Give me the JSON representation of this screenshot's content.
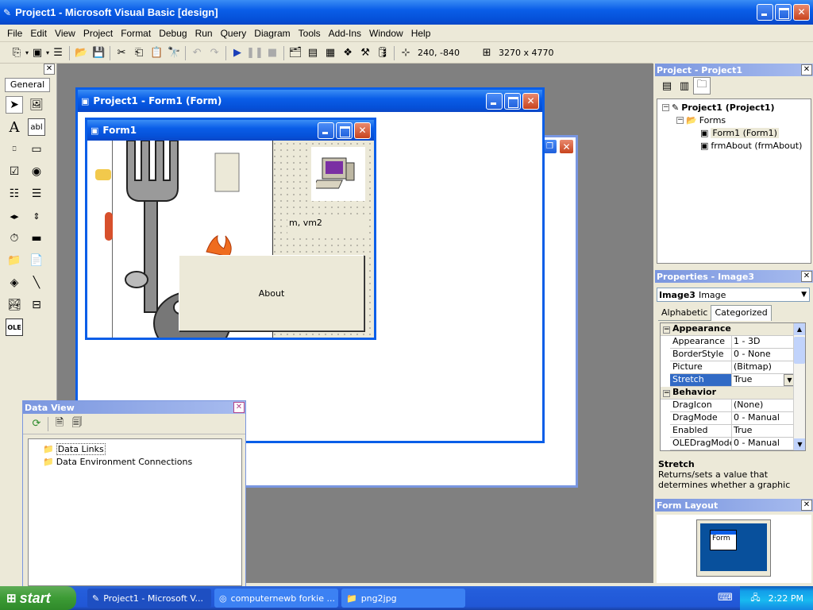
{
  "app": {
    "title": "Project1 - Microsoft Visual Basic [design]"
  },
  "menu": [
    "File",
    "Edit",
    "View",
    "Project",
    "Format",
    "Debug",
    "Run",
    "Query",
    "Diagram",
    "Tools",
    "Add-Ins",
    "Window",
    "Help"
  ],
  "toolbar": {
    "position_readout": "240, -840",
    "size_readout": "3270 x 4770"
  },
  "toolbox": {
    "tab_label": "General"
  },
  "form_designer": {
    "title": "Project1 - Form1 (Form)",
    "form_title": "Form1",
    "label_text": "m, vm2",
    "about_button": "About"
  },
  "project_explorer": {
    "title": "Project - Project1",
    "root": "Project1 (Project1)",
    "folder": "Forms",
    "items": [
      "Form1 (Form1)",
      "frmAbout (frmAbout)"
    ]
  },
  "properties": {
    "title": "Properties - Image3",
    "object_name": "Image3",
    "object_type": "Image",
    "tabs": [
      "Alphabetic",
      "Categorized"
    ],
    "categories": [
      {
        "name": "Appearance",
        "rows": [
          {
            "name": "Appearance",
            "value": "1 - 3D"
          },
          {
            "name": "BorderStyle",
            "value": "0 - None"
          },
          {
            "name": "Picture",
            "value": "(Bitmap)"
          },
          {
            "name": "Stretch",
            "value": "True"
          }
        ]
      },
      {
        "name": "Behavior",
        "rows": [
          {
            "name": "DragIcon",
            "value": "(None)"
          },
          {
            "name": "DragMode",
            "value": "0 - Manual"
          },
          {
            "name": "Enabled",
            "value": "True"
          },
          {
            "name": "OLEDragMode",
            "value": "0 - Manual"
          }
        ]
      }
    ],
    "description_title": "Stretch",
    "description_text": "Returns/sets a value that determines whether a graphic resizes to fit the"
  },
  "form_layout": {
    "title": "Form Layout",
    "form_label": "Form"
  },
  "data_view": {
    "title": "Data View",
    "items": [
      "Data Links",
      "Data Environment Connections"
    ]
  },
  "taskbar": {
    "start_label": "start",
    "tasks": [
      "Project1 - Microsoft V...",
      "computernewb forkie ...",
      "png2jpg"
    ],
    "clock": "2:22 PM"
  },
  "colors": {
    "xp_blue": "#0a5ee8",
    "selection": "#316ac5",
    "start_green": "#3c9b35"
  }
}
